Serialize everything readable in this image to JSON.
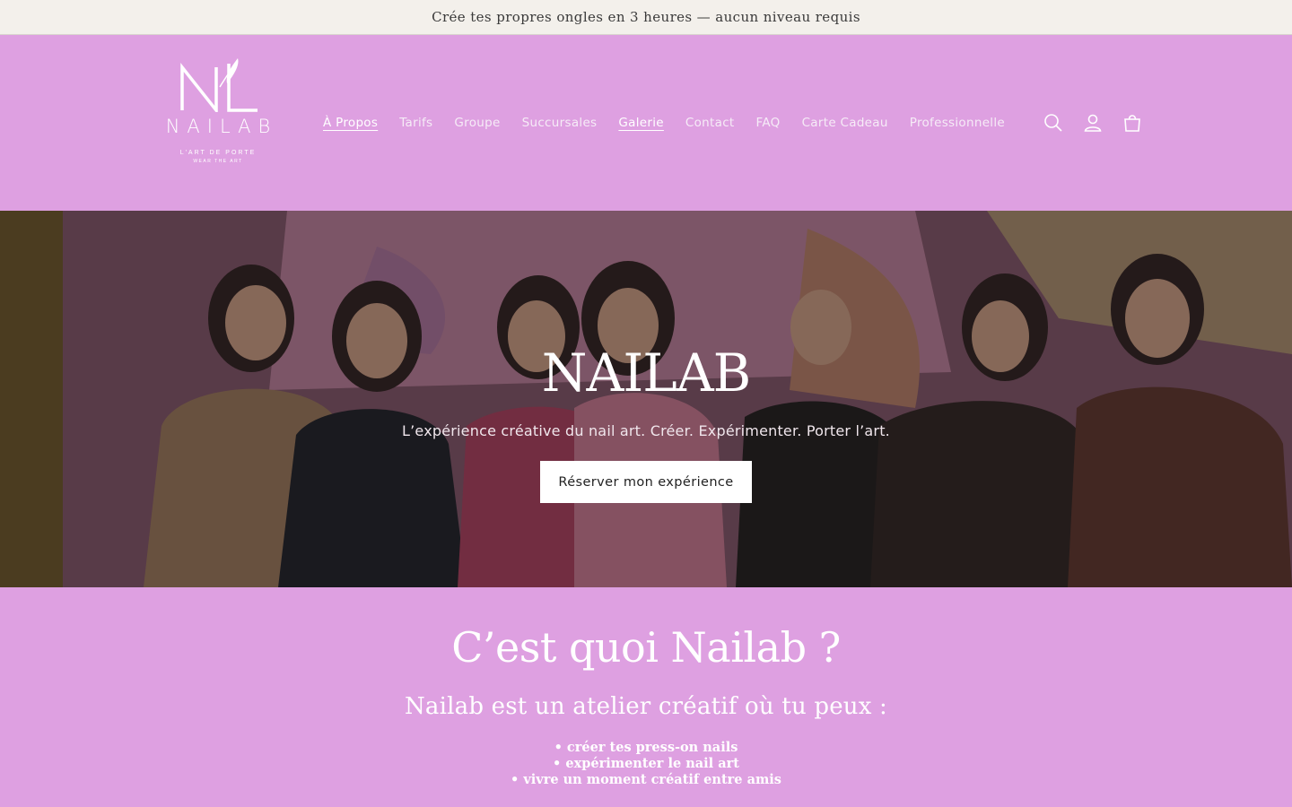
{
  "announcement": {
    "text": "Crée tes propres ongles en 3 heures — aucun niveau requis"
  },
  "logo": {
    "wordmark": "NAILAB",
    "tagline": "L'ART DE PORTE",
    "subtagline": "WEAR THE ART"
  },
  "nav": {
    "items": [
      {
        "label": "À Propos",
        "active": true
      },
      {
        "label": "Tarifs"
      },
      {
        "label": "Groupe"
      },
      {
        "label": "Succursales"
      },
      {
        "label": "Galerie",
        "active": true
      },
      {
        "label": "Contact"
      },
      {
        "label": "FAQ"
      },
      {
        "label": "Carte Cadeau"
      },
      {
        "label": "Professionnelle"
      }
    ]
  },
  "header_icons": [
    "search-icon",
    "account-icon",
    "cart-icon"
  ],
  "hero": {
    "title": "NAILAB",
    "subtitle": "L’expérience créative du nail art. Créer. Expérimenter. Porter l’art.",
    "cta_label": "Réserver mon expérience"
  },
  "about": {
    "heading": "C’est quoi Nailab ?",
    "subheading": "Nailab est un atelier créatif où tu peux :",
    "bullets": [
      "• créer tes press-on nails",
      "• expérimenter le nail art",
      "• vivre un moment créatif entre amis"
    ]
  },
  "colors": {
    "brand_pink": "#dea0e1",
    "announcement_bg": "#f3f0eb"
  }
}
